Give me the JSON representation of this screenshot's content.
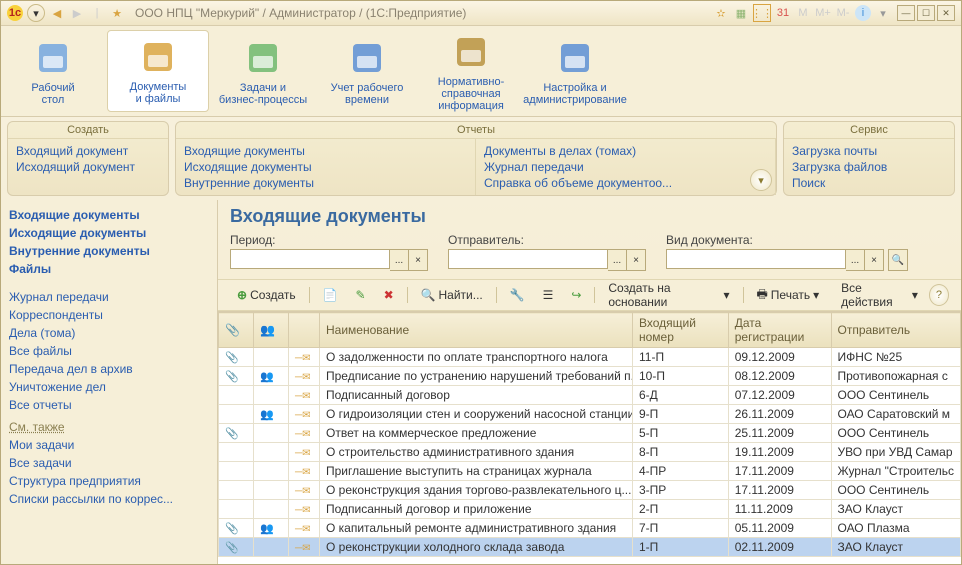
{
  "titlebar": {
    "app_icon": "1c-icon",
    "title": "ООО НПЦ \"Меркурий\" / Администратор /  (1С:Предприятие)"
  },
  "main_tabs": [
    {
      "label_line1": "Рабочий",
      "label_line2": "стол",
      "active": false
    },
    {
      "label_line1": "Документы",
      "label_line2": "и файлы",
      "active": true
    },
    {
      "label_line1": "Задачи и",
      "label_line2": "бизнес-процессы",
      "active": false
    },
    {
      "label_line1": "Учет рабочего",
      "label_line2": "времени",
      "active": false
    },
    {
      "label_line1": "Нормативно-справочная",
      "label_line2": "информация",
      "active": false
    },
    {
      "label_line1": "Настройка и",
      "label_line2": "администрирование",
      "active": false
    }
  ],
  "sidebar": {
    "primary": [
      {
        "label": "Входящие документы",
        "bold": true
      },
      {
        "label": "Исходящие документы",
        "bold": true
      },
      {
        "label": "Внутренние документы",
        "bold": true
      },
      {
        "label": "Файлы",
        "bold": true
      }
    ],
    "secondary": [
      {
        "label": "Журнал передачи"
      },
      {
        "label": "Корреспонденты"
      },
      {
        "label": "Дела (тома)"
      },
      {
        "label": "Все файлы"
      },
      {
        "label": "Передача дел в архив"
      },
      {
        "label": "Уничтожение дел"
      },
      {
        "label": "Все отчеты"
      }
    ],
    "see_also_title": "См. также",
    "see_also": [
      {
        "label": "Мои задачи"
      },
      {
        "label": "Все задачи"
      },
      {
        "label": "Структура предприятия"
      },
      {
        "label": "Списки рассылки по коррес..."
      }
    ]
  },
  "action_panel": {
    "create": {
      "title": "Создать",
      "items": [
        "Входящий документ",
        "Исходящий документ"
      ]
    },
    "reports": {
      "title": "Отчеты",
      "cols": [
        [
          "Входящие документы",
          "Исходящие документы",
          "Внутренние документы"
        ],
        [
          "Документы в делах (томах)",
          "Журнал передачи",
          "Справка об объеме документоо..."
        ]
      ]
    },
    "service": {
      "title": "Сервис",
      "items": [
        "Загрузка почты",
        "Загрузка файлов",
        "Поиск"
      ]
    }
  },
  "doc_title": "Входящие документы",
  "filters": {
    "period_label": "Период:",
    "sender_label": "Отправитель:",
    "doctype_label": "Вид документа:"
  },
  "toolbar": {
    "create": "Создать",
    "find": "Найти...",
    "create_based": "Создать на основании",
    "print": "Печать",
    "all_actions": "Все действия"
  },
  "grid": {
    "columns": [
      "",
      "",
      "",
      "Наименование",
      "Входящий номер",
      "Дата регистрации",
      "Отправитель"
    ],
    "rows": [
      {
        "clip": true,
        "people": false,
        "name": "О задолженности по оплате транспортного налога",
        "num": "11-П",
        "date": "09.12.2009",
        "sender": "ИФНС №25",
        "sel": false
      },
      {
        "clip": true,
        "people": true,
        "name": "Предписание по устранению нарушений требований п...",
        "num": "10-П",
        "date": "08.12.2009",
        "sender": "Противопожарная с",
        "sel": false
      },
      {
        "clip": false,
        "people": false,
        "name": "Подписанный договор",
        "num": "6-Д",
        "date": "07.12.2009",
        "sender": "ООО Сентинель",
        "sel": false
      },
      {
        "clip": false,
        "people": true,
        "name": "О гидроизоляции стен и сооружений насосной станции",
        "num": "9-П",
        "date": "26.11.2009",
        "sender": "ОАО Саратовский м",
        "sel": false
      },
      {
        "clip": true,
        "people": false,
        "name": "Ответ на коммерческое предложение",
        "num": "5-П",
        "date": "25.11.2009",
        "sender": "ООО Сентинель",
        "sel": false
      },
      {
        "clip": false,
        "people": false,
        "name": "О строительство административного здания",
        "num": "8-П",
        "date": "19.11.2009",
        "sender": "УВО при УВД Самар",
        "sel": false
      },
      {
        "clip": false,
        "people": false,
        "name": "Приглашение выступить на страницах журнала",
        "num": "4-ПР",
        "date": "17.11.2009",
        "sender": "Журнал \"Строительс",
        "sel": false
      },
      {
        "clip": false,
        "people": false,
        "name": "О реконструкция здания торгово-развлекательного ц...",
        "num": "3-ПР",
        "date": "17.11.2009",
        "sender": "ООО Сентинель",
        "sel": false
      },
      {
        "clip": false,
        "people": false,
        "name": "Подписанный договор и приложение",
        "num": "2-П",
        "date": "11.11.2009",
        "sender": "ЗАО Клауст",
        "sel": false
      },
      {
        "clip": true,
        "people": true,
        "name": "О капитальный ремонте административного здания",
        "num": "7-П",
        "date": "05.11.2009",
        "sender": "ОАО Плазма",
        "sel": false
      },
      {
        "clip": true,
        "people": false,
        "name": "О реконструкции холодного склада завода",
        "num": "1-П",
        "date": "02.11.2009",
        "sender": "ЗАО Клауст",
        "sel": true
      }
    ]
  }
}
